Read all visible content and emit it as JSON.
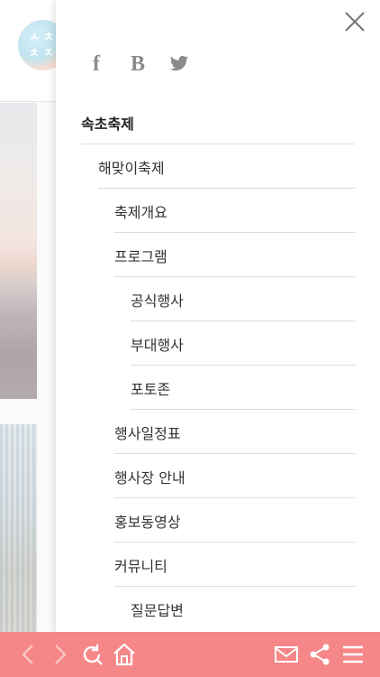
{
  "background": {
    "logo_text": [
      "ㅅ",
      "ㅊ",
      "ㅊ",
      "ㅈ"
    ]
  },
  "drawer": {
    "close_icon": "close-icon",
    "social": [
      {
        "name": "facebook-icon",
        "glyph": "f"
      },
      {
        "name": "blog-icon",
        "glyph": "B"
      },
      {
        "name": "twitter-icon",
        "glyph": "twitter"
      }
    ],
    "menu": [
      {
        "label": "속초축제",
        "level": 0
      },
      {
        "label": "해맞이축제",
        "level": 1
      },
      {
        "label": "축제개요",
        "level": 2
      },
      {
        "label": "프로그램",
        "level": 2
      },
      {
        "label": "공식행사",
        "level": 3
      },
      {
        "label": "부대행사",
        "level": 3
      },
      {
        "label": "포토존",
        "level": 3
      },
      {
        "label": "행사일정표",
        "level": 2
      },
      {
        "label": "행사장 안내",
        "level": 2
      },
      {
        "label": "홍보동영상",
        "level": 2
      },
      {
        "label": "커뮤니티",
        "level": 2
      },
      {
        "label": "질문답변",
        "level": 3
      }
    ]
  },
  "toolbar": {
    "background": "#f58788",
    "icon_color": "#ffffff",
    "icons": [
      "back-icon",
      "forward-icon",
      "refresh-icon",
      "home-icon",
      "mail-icon",
      "share-icon",
      "menu-icon"
    ]
  }
}
